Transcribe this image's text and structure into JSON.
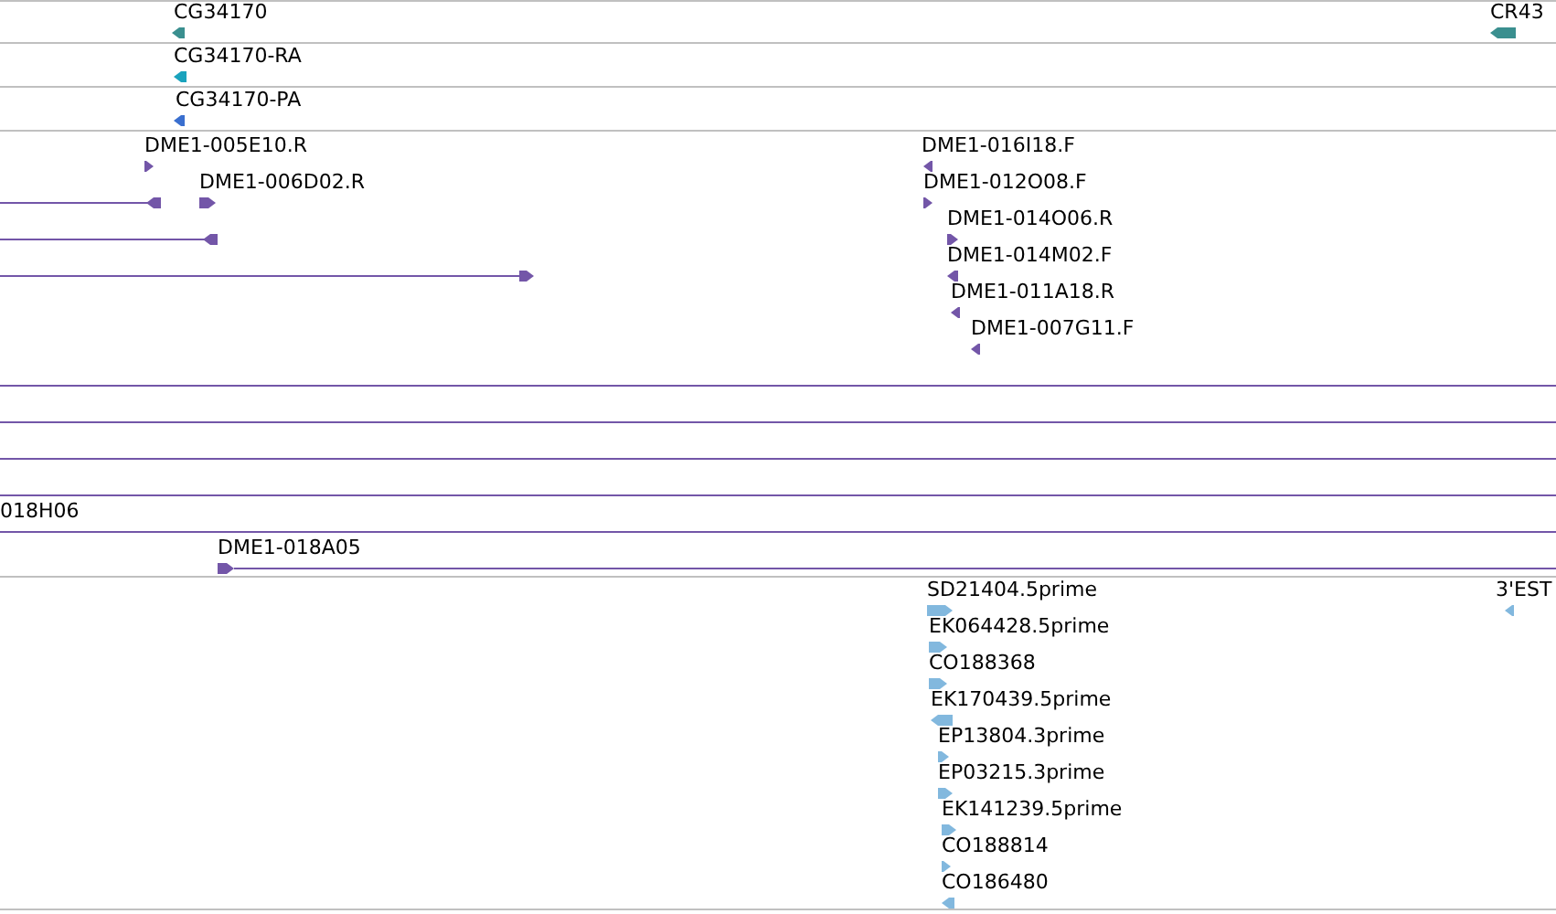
{
  "tracks": [
    {
      "color": "#3a8f8f",
      "features": [
        {
          "kind": "glyph",
          "label": "CG34170",
          "reverse": true
        },
        {
          "kind": "glyph",
          "label": "CR43",
          "reverse": true
        }
      ]
    },
    {
      "color": "#1aa3bd",
      "features": [
        {
          "kind": "glyph",
          "label": "CG34170-RA",
          "reverse": true
        }
      ]
    },
    {
      "color": "#3a6fcf",
      "features": [
        {
          "kind": "glyph",
          "label": "CG34170-PA",
          "reverse": true
        }
      ]
    },
    {
      "color": "#7356a8",
      "features": [
        {
          "kind": "glyph",
          "label": "DME1-005E10.R",
          "reverse": false
        },
        {
          "kind": "left_bar",
          "reverse": true
        },
        {
          "kind": "glyph",
          "label": "DME1-006D02.R",
          "reverse": false
        },
        {
          "kind": "left_bar",
          "reverse": true
        },
        {
          "kind": "left_bar",
          "reverse": false
        },
        {
          "kind": "glyph",
          "label": "DME1-016I18.F",
          "reverse": true
        },
        {
          "kind": "glyph",
          "label": "DME1-012O08.F",
          "reverse": false
        },
        {
          "kind": "glyph",
          "label": "DME1-014O06.R",
          "reverse": false
        },
        {
          "kind": "glyph",
          "label": "DME1-014M02.F",
          "reverse": true
        },
        {
          "kind": "glyph",
          "label": "DME1-011A18.R",
          "reverse": true
        },
        {
          "kind": "glyph",
          "label": "DME1-007G11.F",
          "reverse": true
        },
        {
          "kind": "span"
        },
        {
          "kind": "span"
        },
        {
          "kind": "span"
        },
        {
          "kind": "span"
        },
        {
          "kind": "span",
          "label": "018H06"
        },
        {
          "kind": "right_bar",
          "label": "DME1-018A05",
          "reverse": false
        }
      ]
    },
    {
      "color": "#82b8de",
      "features": [
        {
          "kind": "glyph",
          "label": "SD21404.5prime",
          "reverse": false
        },
        {
          "kind": "glyph",
          "label": "EK064428.5prime",
          "reverse": false
        },
        {
          "kind": "glyph",
          "label": "CO188368",
          "reverse": false
        },
        {
          "kind": "glyph",
          "label": "EK170439.5prime",
          "reverse": true
        },
        {
          "kind": "glyph",
          "label": "EP13804.3prime",
          "reverse": false
        },
        {
          "kind": "glyph",
          "label": "EP03215.3prime",
          "reverse": false
        },
        {
          "kind": "glyph",
          "label": "EK141239.5prime",
          "reverse": false
        },
        {
          "kind": "glyph",
          "label": "CO188814",
          "reverse": false
        },
        {
          "kind": "glyph",
          "label": "CO186480",
          "reverse": true
        },
        {
          "kind": "glyph",
          "label": "3'EST",
          "reverse": true
        }
      ]
    }
  ]
}
